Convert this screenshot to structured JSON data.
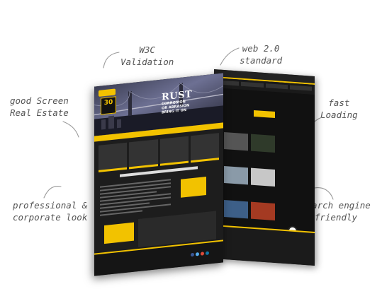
{
  "annotations": {
    "w3c": "W3C\nValidation",
    "web2": "web 2.0\nstandard",
    "screen": "good Screen\nReal Estate",
    "fast": "fast\nLoading",
    "corporate": "professional &\ncorporate look",
    "seo": "Search engine\nfriendly"
  },
  "mockup": {
    "badge_number": "30",
    "hero_title": "RUST",
    "hero_sub_1": "CORROSION",
    "hero_sub_2": "OR ABRASION",
    "hero_sub_3": "BRING IT ON"
  },
  "colors": {
    "accent": "#f2c200",
    "page_bg": "#1d1d1d"
  }
}
